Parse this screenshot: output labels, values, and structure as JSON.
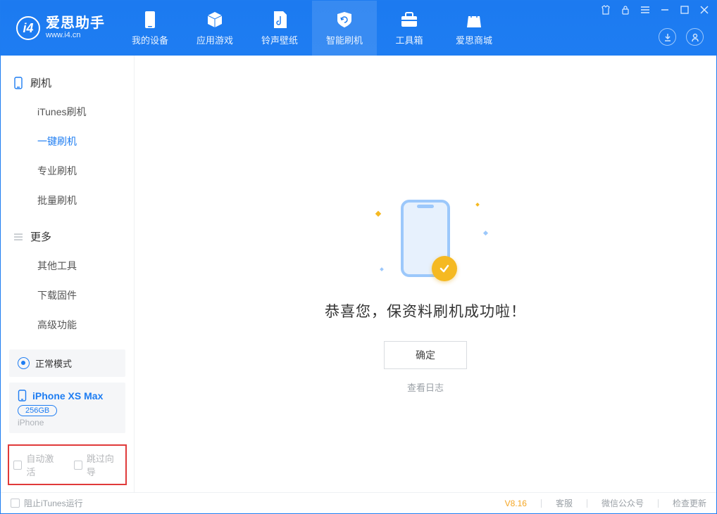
{
  "app": {
    "title": "爱思助手",
    "subtitle": "www.i4.cn"
  },
  "nav": {
    "items": [
      {
        "label": "我的设备"
      },
      {
        "label": "应用游戏"
      },
      {
        "label": "铃声壁纸"
      },
      {
        "label": "智能刷机"
      },
      {
        "label": "工具箱"
      },
      {
        "label": "爱思商城"
      }
    ]
  },
  "sidebar": {
    "group1": "刷机",
    "items1": [
      {
        "label": "iTunes刷机"
      },
      {
        "label": "一键刷机"
      },
      {
        "label": "专业刷机"
      },
      {
        "label": "批量刷机"
      }
    ],
    "group2": "更多",
    "items2": [
      {
        "label": "其他工具"
      },
      {
        "label": "下载固件"
      },
      {
        "label": "高级功能"
      }
    ],
    "mode": "正常模式",
    "device": {
      "name": "iPhone XS Max",
      "storage": "256GB",
      "type": "iPhone"
    },
    "check1": "自动激活",
    "check2": "跳过向导"
  },
  "main": {
    "success": "恭喜您，保资料刷机成功啦！",
    "ok_label": "确定",
    "log_link": "查看日志"
  },
  "statusbar": {
    "block_itunes": "阻止iTunes运行",
    "version": "V8.16",
    "support": "客服",
    "wechat": "微信公众号",
    "update": "检查更新"
  }
}
